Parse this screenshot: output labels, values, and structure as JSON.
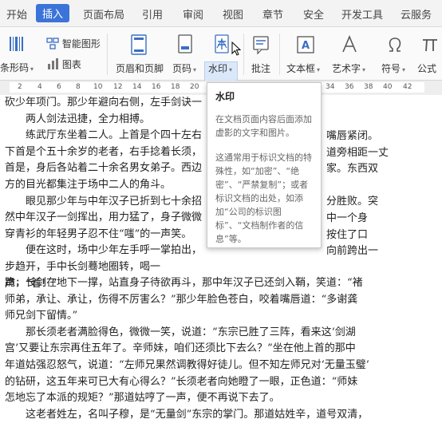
{
  "tabs": [
    "开始",
    "插入",
    "页面布局",
    "引用",
    "审阅",
    "视图",
    "章节",
    "安全",
    "开发工具",
    "云服务"
  ],
  "active_tab": "插入",
  "ribbon": {
    "barcode": "条形码",
    "smart_shape": "智能图形",
    "chart": "图表",
    "header_footer": "页眉和页脚",
    "page_number": "页码",
    "watermark": "水印",
    "comment": "批注",
    "textbox": "文本框",
    "wordart": "艺术字",
    "symbol": "符号",
    "formula": "公式"
  },
  "ruler_numbers": [
    "2",
    "4",
    "6",
    "8",
    "10",
    "12",
    "14",
    "16",
    "18",
    "20",
    "22",
    "24",
    "26",
    "28",
    "30",
    "32",
    "34",
    "36",
    "38",
    "40",
    "42"
  ],
  "tooltip": {
    "title": "水印",
    "desc": "在文档页面内容后面添加虚影的文字和图片。",
    "detail": "这通常用于标识文档的特殊性，如“加密”、“绝密”、“严禁复制”；或者标识文档的出处，如添加“公司的标识图标”、“文档制作者的信息”等。"
  },
  "document": {
    "lines": [
      "砍少年项门。那少年避向右侧，左手剑诀一",
      "　　两人剑法迅捷，全力相搏。",
      "　　练武厅东坐着二人。上首是个四十左右",
      "下首是个五十余岁的老者，右手捻着长须，",
      "首是，身后各站着二十余名男女弟子。西边",
      "方的目光都集注于场中二人的角斗。",
      "　　眼见那少年与中年汉子已折到七十余招",
      "然中年汉子一剑挥出，用力猛了，身子微微",
      "穿青衫的年轻男子忍不住“嗤”的一声笑。",
      "　　便在这时，场中少年左手呼一掌拍出，",
      "步趋开，手中长剑蓦地圈转，喝一声：“着！”",
      "跪，长剑在地下一撑，站直身子待欲再斗，那中年汉子已还剑入鞘，笑道：“褚",
      "师弟，承让、承让，伤得不厉害么？”那少年脸色苍白，咬着嘴唇道：“多谢龚",
      "师兄剑下留情。”",
      "　　那长须老者满脸得色，微微一笑，说道：“东宗已胜了三阵，看来这‘剑湖",
      "宫’又要让东宗再住五年了。辛师妹，咱们还须比下去么？”坐在他上首的那中",
      "年道姑强忍怒气，说道：“左师兄果然调教得好徒儿。但不知左师兄对‘无量玉璧’",
      "的钻研，这五年来可已大有心得么？”长须老者向她瞪了一眼，正色道：“师妹",
      "怎地忘了本派的规矩？”那道姑哼了一声，便不再说下去了。",
      "　　这老者姓左，名叫子穆，是“无量剑”东宗的掌门。那道姑姓辛，道号双清，"
    ],
    "right_fragments": [
      "嘴唇紧闭。",
      "道旁相距一丈",
      "家。东西双",
      "分胜败。突",
      "中一个身",
      "按住了口",
      "向前跨出一"
    ]
  }
}
